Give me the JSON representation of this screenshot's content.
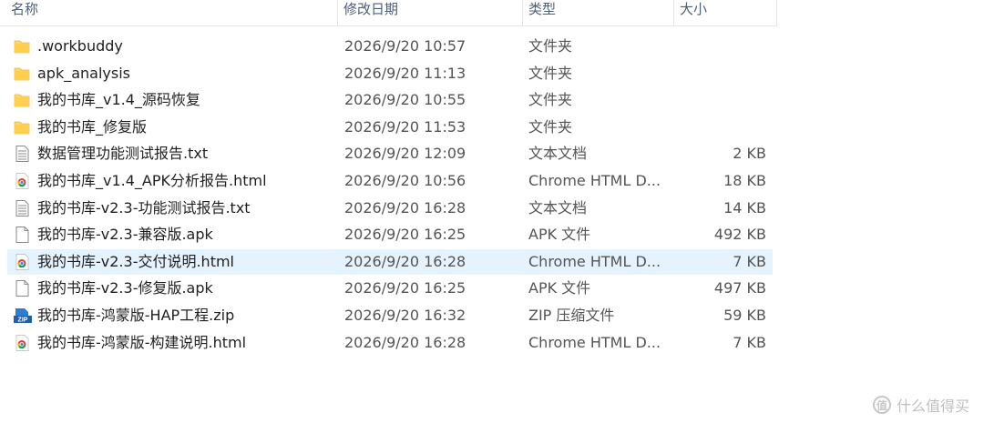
{
  "columns": {
    "name": "名称",
    "date": "修改日期",
    "type": "类型",
    "size": "大小"
  },
  "files": [
    {
      "icon": "folder-icon",
      "name": ".workbuddy",
      "date": "2026/9/20 10:57",
      "type": "文件夹",
      "size": ""
    },
    {
      "icon": "folder-icon",
      "name": "apk_analysis",
      "date": "2026/9/20 11:13",
      "type": "文件夹",
      "size": ""
    },
    {
      "icon": "folder-icon",
      "name": "我的书库_v1.4_源码恢复",
      "date": "2026/9/20 10:55",
      "type": "文件夹",
      "size": ""
    },
    {
      "icon": "folder-icon",
      "name": "我的书库_修复版",
      "date": "2026/9/20 11:53",
      "type": "文件夹",
      "size": ""
    },
    {
      "icon": "text-file-icon",
      "name": "数据管理功能测试报告.txt",
      "date": "2026/9/20 12:09",
      "type": "文本文档",
      "size": "2 KB"
    },
    {
      "icon": "chrome-html-icon",
      "name": "我的书库_v1.4_APK分析报告.html",
      "date": "2026/9/20 10:56",
      "type": "Chrome HTML D...",
      "size": "18 KB"
    },
    {
      "icon": "text-file-icon",
      "name": "我的书库-v2.3-功能测试报告.txt",
      "date": "2026/9/20 16:28",
      "type": "文本文档",
      "size": "14 KB"
    },
    {
      "icon": "blank-file-icon",
      "name": "我的书库-v2.3-兼容版.apk",
      "date": "2026/9/20 16:25",
      "type": "APK 文件",
      "size": "492 KB"
    },
    {
      "icon": "chrome-html-icon",
      "name": "我的书库-v2.3-交付说明.html",
      "date": "2026/9/20 16:28",
      "type": "Chrome HTML D...",
      "size": "7 KB",
      "selected": true
    },
    {
      "icon": "blank-file-icon",
      "name": "我的书库-v2.3-修复版.apk",
      "date": "2026/9/20 16:25",
      "type": "APK 文件",
      "size": "497 KB"
    },
    {
      "icon": "zip-icon",
      "name": "我的书库-鸿蒙版-HAP工程.zip",
      "date": "2026/9/20 16:32",
      "type": "ZIP 压缩文件",
      "size": "59 KB"
    },
    {
      "icon": "chrome-html-icon",
      "name": "我的书库-鸿蒙版-构建说明.html",
      "date": "2026/9/20 16:28",
      "type": "Chrome HTML D...",
      "size": "7 KB"
    }
  ],
  "watermark": {
    "logo": "值",
    "text": "什么值得买"
  },
  "colors": {
    "folder": "#ffd766",
    "selected_bg": "#e5f3ff",
    "header_text": "#4c607a"
  }
}
